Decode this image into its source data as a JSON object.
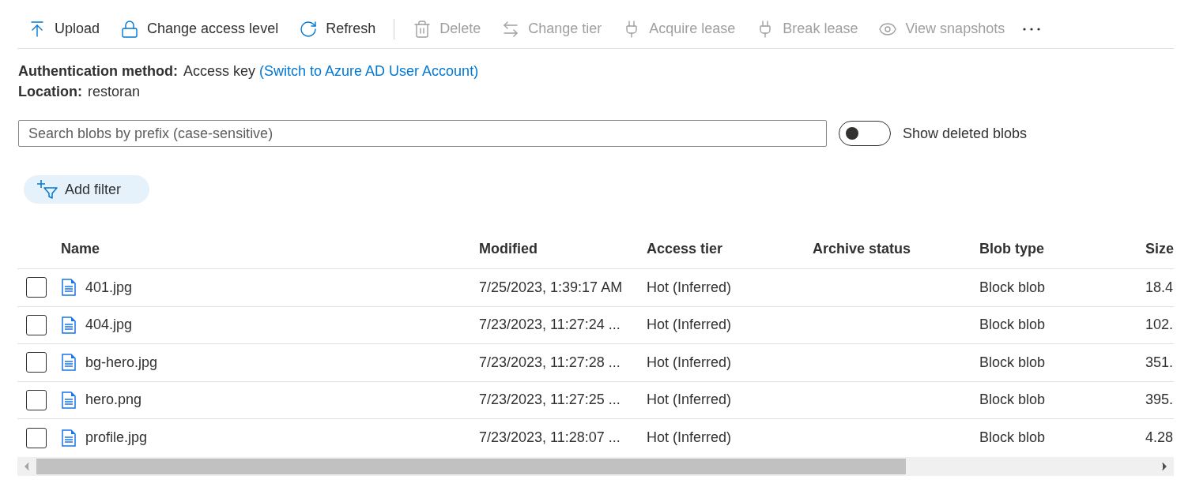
{
  "toolbar": [
    {
      "label": "Upload",
      "disabled": false
    },
    {
      "label": "Change access level",
      "disabled": false
    },
    {
      "label": "Refresh",
      "disabled": false
    },
    {
      "label": "Delete",
      "disabled": true
    },
    {
      "label": "Change tier",
      "disabled": true
    },
    {
      "label": "Acquire lease",
      "disabled": true
    },
    {
      "label": "Break lease",
      "disabled": true
    },
    {
      "label": "View snapshots",
      "disabled": true
    }
  ],
  "info": [
    {
      "label": "Authentication method:",
      "value": "Access key",
      "link": "(Switch to Azure AD User Account)"
    },
    {
      "label": "Location:",
      "value": "restoran"
    }
  ],
  "search": {
    "placeholder": "Search blobs by prefix (case-sensitive)"
  },
  "show_deleted": {
    "label": "Show deleted blobs",
    "on": false
  },
  "add_filter": {
    "label": "Add filter"
  },
  "table": {
    "columns": [
      "Name",
      "Modified",
      "Access tier",
      "Archive status",
      "Blob type",
      "Size"
    ],
    "rows": [
      {
        "checked": false,
        "cells": [
          "401.jpg",
          "7/25/2023, 1:39:17 AM",
          "Hot (Inferred)",
          "",
          "Block blob",
          "18.4"
        ]
      },
      {
        "checked": false,
        "cells": [
          "404.jpg",
          "7/23/2023, 11:27:24 ...",
          "Hot (Inferred)",
          "",
          "Block blob",
          "102."
        ]
      },
      {
        "checked": false,
        "cells": [
          "bg-hero.jpg",
          "7/23/2023, 11:27:28 ...",
          "Hot (Inferred)",
          "",
          "Block blob",
          "351."
        ]
      },
      {
        "checked": false,
        "cells": [
          "hero.png",
          "7/23/2023, 11:27:25 ...",
          "Hot (Inferred)",
          "",
          "Block blob",
          "395."
        ]
      },
      {
        "checked": false,
        "cells": [
          "profile.jpg",
          "7/23/2023, 11:28:07 ...",
          "Hot (Inferred)",
          "",
          "Block blob",
          "4.28"
        ]
      }
    ]
  }
}
